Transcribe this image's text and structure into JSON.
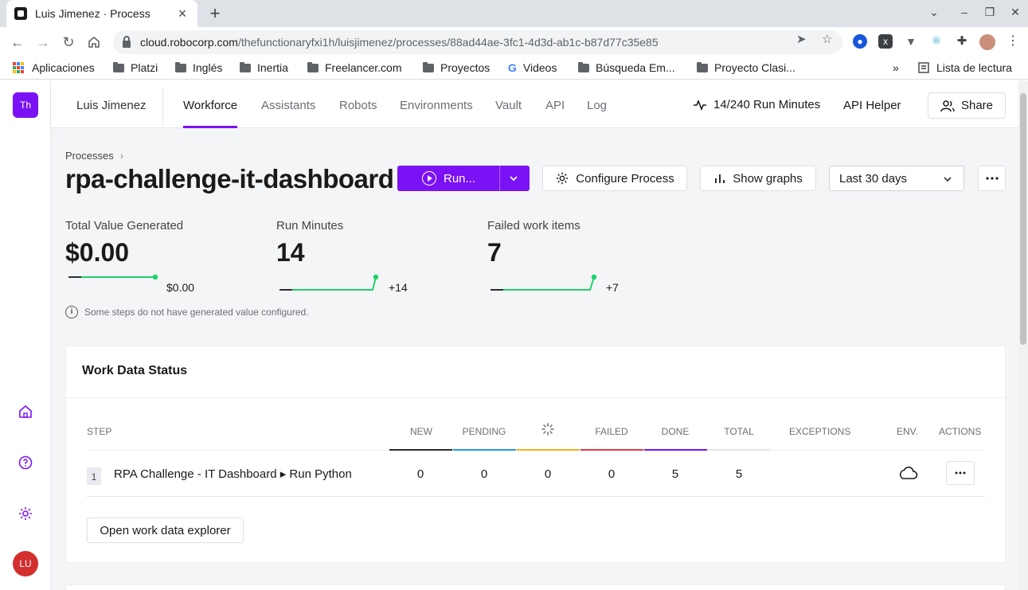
{
  "browser": {
    "tab_title": "Luis Jimenez · Process",
    "url_domain": "cloud.robocorp.com",
    "url_path": "/thefunctionaryfxi1h/luisjimenez/processes/88ad44ae-3fc1-4d3d-ab1c-b87d77c35e85",
    "bookmarks": [
      {
        "label": "Aplicaciones",
        "icon": "apps-grid-icon"
      },
      {
        "label": "Platzi",
        "icon": "folder-icon"
      },
      {
        "label": "Inglés",
        "icon": "folder-icon"
      },
      {
        "label": "Inertia",
        "icon": "folder-icon"
      },
      {
        "label": "Freelancer.com",
        "icon": "folder-icon"
      },
      {
        "label": "Proyectos",
        "icon": "folder-icon"
      },
      {
        "label": "Videos",
        "icon": "google-icon"
      },
      {
        "label": "Búsqueda Em...",
        "icon": "folder-icon"
      },
      {
        "label": "Proyecto Clasi...",
        "icon": "folder-icon"
      }
    ],
    "overflow": "»",
    "reading_list": "Lista de lectura"
  },
  "sidebar": {
    "workspace_badge": "Th",
    "user_avatar": "LU",
    "accent": "#7b12f5"
  },
  "topnav": {
    "org_name": "Luis Jimenez",
    "items": [
      "Workforce",
      "Assistants",
      "Robots",
      "Environments",
      "Vault",
      "API",
      "Log"
    ],
    "active_item": "Workforce",
    "run_minutes": "14/240 Run Minutes",
    "api_helper": "API Helper",
    "share": "Share"
  },
  "process": {
    "breadcrumb": "Processes",
    "title": "rpa-challenge-it-dashboard",
    "run_button": "Run...",
    "configure_button": "Configure Process",
    "graphs_button": "Show graphs",
    "period": "Last 30 days"
  },
  "metrics": [
    {
      "label": "Total Value Generated",
      "value": "$0.00",
      "delta": "$0.00"
    },
    {
      "label": "Run Minutes",
      "value": "14",
      "delta": "+14"
    },
    {
      "label": "Failed work items",
      "value": "7",
      "delta": "+7"
    }
  ],
  "note": "Some steps do not have generated value configured.",
  "work_data": {
    "title": "Work Data Status",
    "headers": {
      "step": "STEP",
      "new": "NEW",
      "pending": "PENDING",
      "failed": "FAILED",
      "done": "DONE",
      "total": "TOTAL",
      "exceptions": "EXCEPTIONS",
      "env": "ENV.",
      "actions": "ACTIONS"
    },
    "column_colors": [
      "#2b2d33",
      "#1fa0d8",
      "#f2b01e",
      "#e2384d",
      "#7b12f5",
      "#e3e5ea"
    ],
    "rows": [
      {
        "num": "1",
        "step": "RPA Challenge - IT Dashboard ▸ Run Python",
        "new": "0",
        "pending": "0",
        "in_progress": "0",
        "failed": "0",
        "done": "5",
        "total": "5",
        "env_icon": "cloud-icon"
      }
    ],
    "explorer_button": "Open work data explorer"
  }
}
